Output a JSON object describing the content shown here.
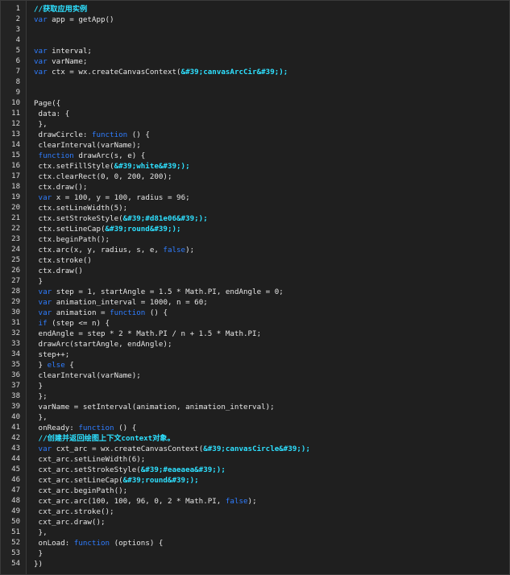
{
  "colors": {
    "background": "#1f1f1f",
    "gutter": "#232323",
    "text": "#e6e6e6",
    "keyword": "#2f7dff",
    "string": "#2ee0ff",
    "comment": "#2ee0ff"
  },
  "editor": {
    "lines": [
      {
        "n": "1",
        "tokens": [
          {
            "t": "cm",
            "v": "//获取应用实例"
          }
        ]
      },
      {
        "n": "2",
        "tokens": [
          {
            "t": "kw",
            "v": "var"
          },
          {
            "t": "txt",
            "v": " app = getApp()"
          }
        ]
      },
      {
        "n": "3",
        "tokens": []
      },
      {
        "n": "4",
        "tokens": []
      },
      {
        "n": "5",
        "tokens": [
          {
            "t": "kw",
            "v": "var"
          },
          {
            "t": "txt",
            "v": " interval;"
          }
        ]
      },
      {
        "n": "6",
        "tokens": [
          {
            "t": "kw",
            "v": "var"
          },
          {
            "t": "txt",
            "v": " varName;"
          }
        ]
      },
      {
        "n": "7",
        "tokens": [
          {
            "t": "kw",
            "v": "var"
          },
          {
            "t": "txt",
            "v": " ctx = wx.createCanvasContext("
          },
          {
            "t": "str",
            "v": "&#39;canvasArcCir&#39;);"
          }
        ]
      },
      {
        "n": "8",
        "tokens": []
      },
      {
        "n": "9",
        "tokens": []
      },
      {
        "n": "10",
        "tokens": [
          {
            "t": "txt",
            "v": "Page({"
          }
        ]
      },
      {
        "n": "11",
        "tokens": [
          {
            "t": "txt",
            "v": " data: {"
          }
        ]
      },
      {
        "n": "12",
        "tokens": [
          {
            "t": "txt",
            "v": " },"
          }
        ]
      },
      {
        "n": "13",
        "tokens": [
          {
            "t": "txt",
            "v": " drawCircle: "
          },
          {
            "t": "kw",
            "v": "function"
          },
          {
            "t": "txt",
            "v": " () {"
          }
        ]
      },
      {
        "n": "14",
        "tokens": [
          {
            "t": "txt",
            "v": " clearInterval(varName);"
          }
        ]
      },
      {
        "n": "15",
        "tokens": [
          {
            "t": "txt",
            "v": " "
          },
          {
            "t": "kw",
            "v": "function"
          },
          {
            "t": "txt",
            "v": " drawArc(s, e) {"
          }
        ]
      },
      {
        "n": "16",
        "tokens": [
          {
            "t": "txt",
            "v": " ctx.setFillStyle("
          },
          {
            "t": "str",
            "v": "&#39;white&#39;);"
          }
        ]
      },
      {
        "n": "17",
        "tokens": [
          {
            "t": "txt",
            "v": " ctx.clearRect(0, 0, 200, 200);"
          }
        ]
      },
      {
        "n": "18",
        "tokens": [
          {
            "t": "txt",
            "v": " ctx.draw();"
          }
        ]
      },
      {
        "n": "19",
        "tokens": [
          {
            "t": "txt",
            "v": " "
          },
          {
            "t": "kw",
            "v": "var"
          },
          {
            "t": "txt",
            "v": " x = 100, y = 100, radius = 96;"
          }
        ]
      },
      {
        "n": "20",
        "tokens": [
          {
            "t": "txt",
            "v": " ctx.setLineWidth(5);"
          }
        ]
      },
      {
        "n": "21",
        "tokens": [
          {
            "t": "txt",
            "v": " ctx.setStrokeStyle("
          },
          {
            "t": "str",
            "v": "&#39;#d81e06&#39;);"
          }
        ]
      },
      {
        "n": "22",
        "tokens": [
          {
            "t": "txt",
            "v": " ctx.setLineCap("
          },
          {
            "t": "str",
            "v": "&#39;round&#39;);"
          }
        ]
      },
      {
        "n": "23",
        "tokens": [
          {
            "t": "txt",
            "v": " ctx.beginPath();"
          }
        ]
      },
      {
        "n": "24",
        "tokens": [
          {
            "t": "txt",
            "v": " ctx.arc(x, y, radius, s, e, "
          },
          {
            "t": "kw",
            "v": "false"
          },
          {
            "t": "txt",
            "v": ");"
          }
        ]
      },
      {
        "n": "25",
        "tokens": [
          {
            "t": "txt",
            "v": " ctx.stroke()"
          }
        ]
      },
      {
        "n": "26",
        "tokens": [
          {
            "t": "txt",
            "v": " ctx.draw()"
          }
        ]
      },
      {
        "n": "27",
        "tokens": [
          {
            "t": "txt",
            "v": " }"
          }
        ]
      },
      {
        "n": "28",
        "tokens": [
          {
            "t": "txt",
            "v": " "
          },
          {
            "t": "kw",
            "v": "var"
          },
          {
            "t": "txt",
            "v": " step = 1, startAngle = 1.5 * Math.PI, endAngle = 0;"
          }
        ]
      },
      {
        "n": "29",
        "tokens": [
          {
            "t": "txt",
            "v": " "
          },
          {
            "t": "kw",
            "v": "var"
          },
          {
            "t": "txt",
            "v": " animation_interval = 1000, n = 60;"
          }
        ]
      },
      {
        "n": "30",
        "tokens": [
          {
            "t": "txt",
            "v": " "
          },
          {
            "t": "kw",
            "v": "var"
          },
          {
            "t": "txt",
            "v": " animation = "
          },
          {
            "t": "kw",
            "v": "function"
          },
          {
            "t": "txt",
            "v": " () {"
          }
        ]
      },
      {
        "n": "31",
        "tokens": [
          {
            "t": "txt",
            "v": " "
          },
          {
            "t": "kw",
            "v": "if"
          },
          {
            "t": "txt",
            "v": " (step <= n) {"
          }
        ]
      },
      {
        "n": "32",
        "tokens": [
          {
            "t": "txt",
            "v": " endAngle = step * 2 * Math.PI / n + 1.5 * Math.PI;"
          }
        ]
      },
      {
        "n": "33",
        "tokens": [
          {
            "t": "txt",
            "v": " drawArc(startAngle, endAngle);"
          }
        ]
      },
      {
        "n": "34",
        "tokens": [
          {
            "t": "txt",
            "v": " step++;"
          }
        ]
      },
      {
        "n": "35",
        "tokens": [
          {
            "t": "txt",
            "v": " } "
          },
          {
            "t": "kw",
            "v": "else"
          },
          {
            "t": "txt",
            "v": " {"
          }
        ]
      },
      {
        "n": "36",
        "tokens": [
          {
            "t": "txt",
            "v": " clearInterval(varName);"
          }
        ]
      },
      {
        "n": "37",
        "tokens": [
          {
            "t": "txt",
            "v": " }"
          }
        ]
      },
      {
        "n": "38",
        "tokens": [
          {
            "t": "txt",
            "v": " };"
          }
        ]
      },
      {
        "n": "39",
        "tokens": [
          {
            "t": "txt",
            "v": " varName = setInterval(animation, animation_interval);"
          }
        ]
      },
      {
        "n": "40",
        "tokens": [
          {
            "t": "txt",
            "v": " },"
          }
        ]
      },
      {
        "n": "41",
        "tokens": [
          {
            "t": "txt",
            "v": " onReady: "
          },
          {
            "t": "kw",
            "v": "function"
          },
          {
            "t": "txt",
            "v": " () {"
          }
        ]
      },
      {
        "n": "42",
        "tokens": [
          {
            "t": "txt",
            "v": " "
          },
          {
            "t": "cm",
            "v": "//创建并返回绘图上下文context对象。"
          }
        ]
      },
      {
        "n": "43",
        "tokens": [
          {
            "t": "txt",
            "v": " "
          },
          {
            "t": "kw",
            "v": "var"
          },
          {
            "t": "txt",
            "v": " cxt_arc = wx.createCanvasContext("
          },
          {
            "t": "str",
            "v": "&#39;canvasCircle&#39;);"
          }
        ]
      },
      {
        "n": "44",
        "tokens": [
          {
            "t": "txt",
            "v": " cxt_arc.setLineWidth(6);"
          }
        ]
      },
      {
        "n": "45",
        "tokens": [
          {
            "t": "txt",
            "v": " cxt_arc.setStrokeStyle("
          },
          {
            "t": "str",
            "v": "&#39;#eaeaea&#39;);"
          }
        ]
      },
      {
        "n": "46",
        "tokens": [
          {
            "t": "txt",
            "v": " cxt_arc.setLineCap("
          },
          {
            "t": "str",
            "v": "&#39;round&#39;);"
          }
        ]
      },
      {
        "n": "47",
        "tokens": [
          {
            "t": "txt",
            "v": " cxt_arc.beginPath();"
          }
        ]
      },
      {
        "n": "48",
        "tokens": [
          {
            "t": "txt",
            "v": " cxt_arc.arc(100, 100, 96, 0, 2 * Math.PI, "
          },
          {
            "t": "kw",
            "v": "false"
          },
          {
            "t": "txt",
            "v": ");"
          }
        ]
      },
      {
        "n": "49",
        "tokens": [
          {
            "t": "txt",
            "v": " cxt_arc.stroke();"
          }
        ]
      },
      {
        "n": "50",
        "tokens": [
          {
            "t": "txt",
            "v": " cxt_arc.draw();"
          }
        ]
      },
      {
        "n": "51",
        "tokens": [
          {
            "t": "txt",
            "v": " },"
          }
        ]
      },
      {
        "n": "52",
        "tokens": [
          {
            "t": "txt",
            "v": " onLoad: "
          },
          {
            "t": "kw",
            "v": "function"
          },
          {
            "t": "txt",
            "v": " (options) {"
          }
        ]
      },
      {
        "n": "53",
        "tokens": [
          {
            "t": "txt",
            "v": " }"
          }
        ]
      },
      {
        "n": "54",
        "tokens": [
          {
            "t": "txt",
            "v": "})"
          }
        ]
      }
    ]
  }
}
